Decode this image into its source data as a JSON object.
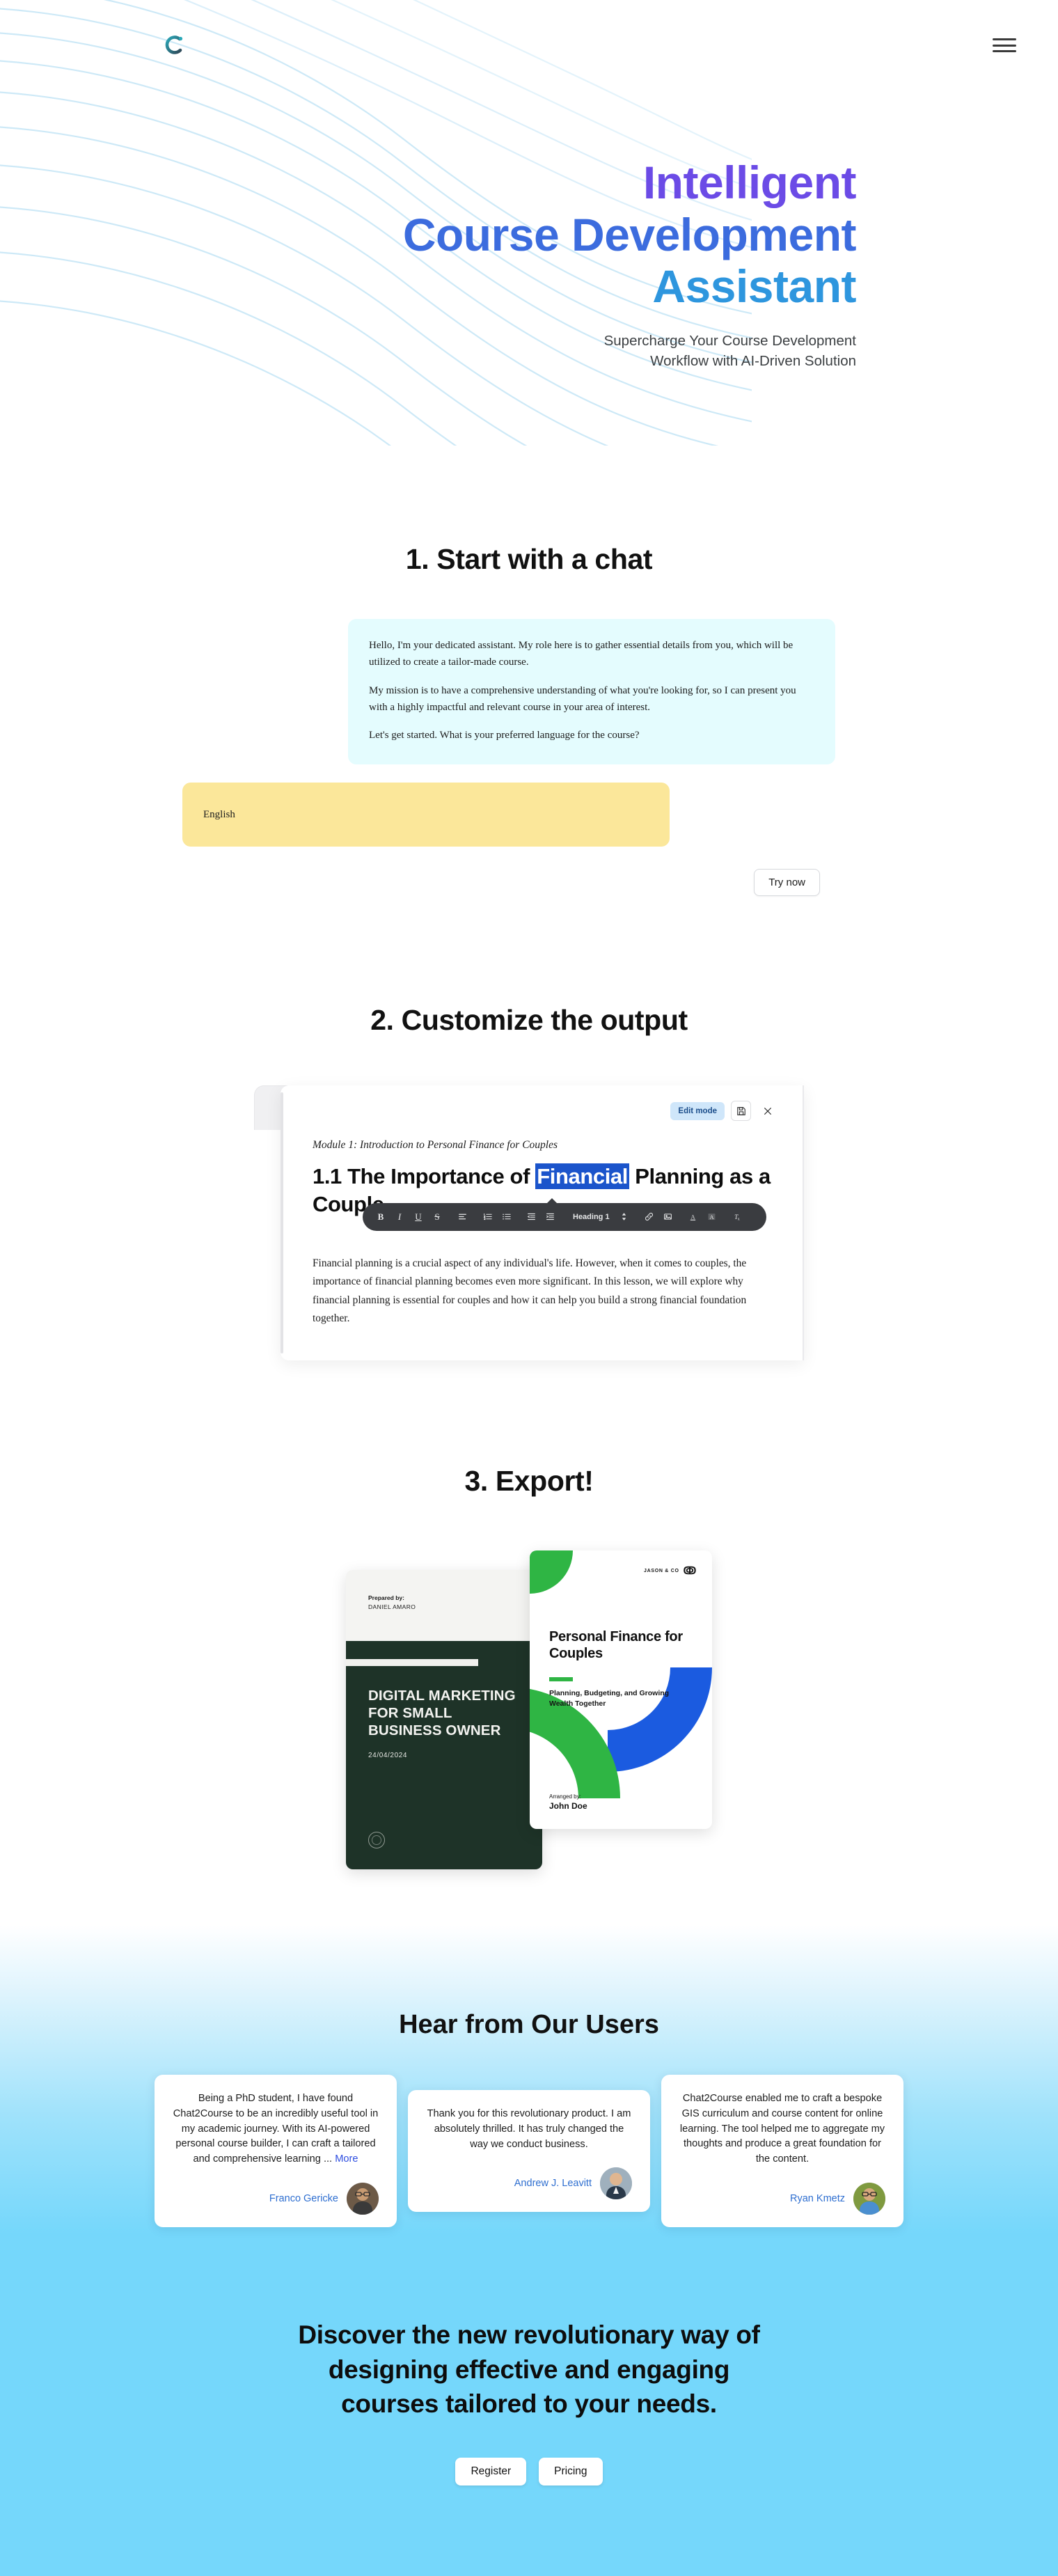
{
  "brand": {
    "logo_icon": "chat2course-c-logo-icon",
    "logo_color_start": "#2AA8B8",
    "logo_color_end": "#2F4858"
  },
  "topbar": {
    "menu_icon": "hamburger-menu-icon"
  },
  "hero": {
    "title_line1": "Intelligent",
    "title_line2": "Course Development",
    "title_line3": "Assistant",
    "color_line1": "#6B4BE6",
    "color_line2": "#3C6CDE",
    "color_line3": "#2E96DE",
    "subtitle_line1": "Supercharge Your Course Development",
    "subtitle_line2": "Workflow with AI-Driven Solution"
  },
  "step1": {
    "heading": "1. Start with a chat",
    "assistant_p1": "Hello, I'm your dedicated assistant. My role here is to gather essential details from you, which will be utilized to create a tailor-made course.",
    "assistant_p2": "My mission is to have a comprehensive understanding of what you're looking for, so I can present you with a highly impactful and relevant course in your area of interest.",
    "assistant_p3": "Let's get started. What is your preferred language for the course?",
    "user_message": "English",
    "try_now_label": "Try now",
    "assistant_bubble_color": "#E4FCFE",
    "user_bubble_color": "#FBE79A"
  },
  "step2": {
    "heading": "2. Customize the output",
    "edit_mode_label": "Edit mode",
    "save_icon": "save-disk-icon",
    "close_icon": "close-x-icon",
    "module_label": "Module 1: Introduction to Personal Finance for Couples",
    "doc_heading_before": "1.1 The Importance of ",
    "doc_heading_selected": "Financial",
    "doc_heading_after": " Planning as a Couple",
    "selection_color": "#1B54CB",
    "toolbar": {
      "bold": "B",
      "italic": "I",
      "underline": "U",
      "strikethrough": "S",
      "align_icon": "align-left-icon",
      "ordered_list_icon": "ordered-list-icon",
      "bullet_list_icon": "bullet-list-icon",
      "outdent_icon": "outdent-icon",
      "indent_icon": "indent-icon",
      "heading_select": "Heading 1",
      "heading_caret_icon": "updown-caret-icon",
      "link_icon": "link-icon",
      "image_icon": "image-icon",
      "text_color_icon": "text-color-a-icon",
      "highlight_icon": "highlight-a-icon",
      "clear_format_icon": "clear-format-tx-icon"
    },
    "doc_body": "Financial planning is a crucial aspect of any individual's life. However, when it comes to couples, the importance of financial planning becomes even more significant. In this lesson, we will explore why financial planning is essential for couples and how it can help you build a strong financial foundation together."
  },
  "step3": {
    "heading": "3. Export!",
    "cover_a": {
      "prepared_label": "Prepared by:",
      "prepared_name": "DANIEL AMARO",
      "title": "DIGITAL MARKETING FOR SMALL BUSINESS OWNER",
      "date": "24/04/2024",
      "background": "#1E3328",
      "seal_icon": "seal-badge-icon"
    },
    "cover_b": {
      "brand": "JASON & CO",
      "brand_icon": "jason-co-mark-icon",
      "title": "Personal Finance for Couples",
      "subtitle": "Planning, Budgeting, and Growing Wealth Together",
      "arranged_label": "Arranged by:",
      "arranged_name": "John Doe",
      "accent_green": "#2FB544",
      "accent_blue": "#1B5BE0"
    }
  },
  "testimonials": {
    "heading": "Hear from Our Users",
    "items": [
      {
        "quote": "Being a PhD student, I have found Chat2Course to be an incredibly useful tool in my academic journey. With its AI-powered personal course builder, I can craft a tailored and comprehensive learning ...",
        "more_label": "More",
        "name": "Franco Gericke",
        "avatar_icon": "user-avatar-icon"
      },
      {
        "quote": "Thank you for this revolutionary product. I am absolutely thrilled. It has truly changed the way we conduct business.",
        "more_label": "",
        "name": "Andrew J. Leavitt",
        "avatar_icon": "user-avatar-icon"
      },
      {
        "quote": "Chat2Course enabled me to craft a bespoke GIS curriculum and course content for online learning. The tool helped me to aggregate my thoughts and produce a great foundation for the content.",
        "more_label": "",
        "name": "Ryan Kmetz",
        "avatar_icon": "user-avatar-icon"
      }
    ]
  },
  "cta": {
    "line1": "Discover the new revolutionary way of",
    "line2": "designing effective and engaging",
    "line3": "courses tailored to your needs.",
    "register_label": "Register",
    "pricing_label": "Pricing",
    "background": "#75D7FB"
  }
}
